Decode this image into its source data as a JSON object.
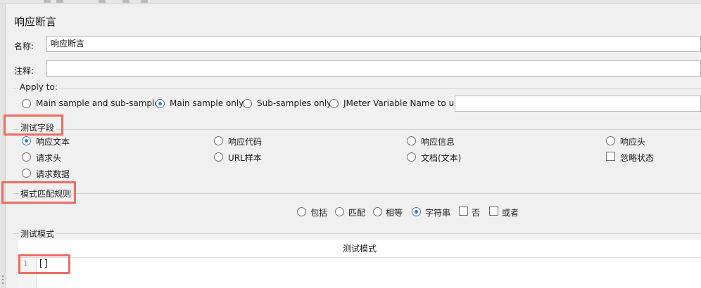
{
  "title": "响应断言",
  "name_field": {
    "label": "名称:",
    "value": "响应断言"
  },
  "comment_field": {
    "label": "注释:",
    "value": ""
  },
  "apply_to": {
    "title": "Apply to:",
    "options": [
      "Main sample and sub-samples",
      "Main sample only",
      "Sub-samples only",
      "JMeter Variable Name to use"
    ],
    "selected": "Main sample only",
    "variable_value": ""
  },
  "field_to_test": {
    "title": "测试字段",
    "options": [
      "响应文本",
      "响应代码",
      "响应信息",
      "响应头",
      "请求头",
      "URL样本",
      "文档(文本)",
      "请求数据"
    ],
    "selected": "响应文本",
    "ignore_status_label": "忽略状态"
  },
  "pattern_rules": {
    "title": "模式匹配规则",
    "options": [
      "包括",
      "匹配",
      "相等",
      "字符串"
    ],
    "selected": "字符串",
    "not_label": "否",
    "or_label": "或者"
  },
  "patterns": {
    "title": "测试模式",
    "column_header": "测试模式",
    "line_number": "1",
    "line_text": "[]"
  },
  "colors": {
    "accent": "#3d74c6",
    "highlight": "#ef6b61"
  }
}
